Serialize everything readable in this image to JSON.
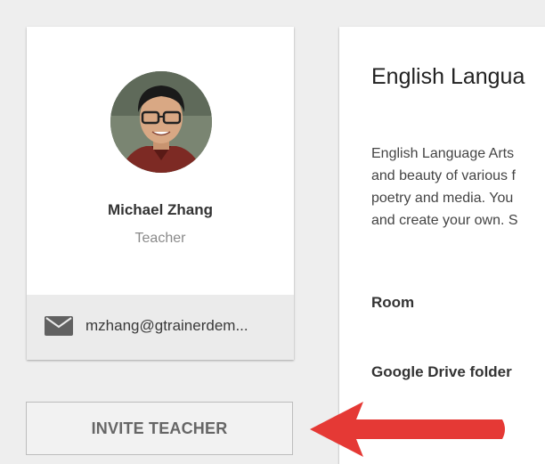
{
  "teacher": {
    "name": "Michael Zhang",
    "role": "Teacher",
    "email": "mzhang@gtrainerdem..."
  },
  "invite_button_label": "INVITE TEACHER",
  "class": {
    "title": "English Langua",
    "description_lines": [
      "English Language Arts",
      "and beauty of various f",
      "poetry and media. You",
      "and create your own. S"
    ],
    "room_label": "Room",
    "drive_label": "Google Drive folder"
  },
  "colors": {
    "arrow": "#e53935",
    "background": "#eeeeee",
    "card": "#ffffff",
    "email_row": "#ebebeb"
  },
  "icons": {
    "mail": "mail-icon",
    "arrow": "left-arrow-icon"
  }
}
